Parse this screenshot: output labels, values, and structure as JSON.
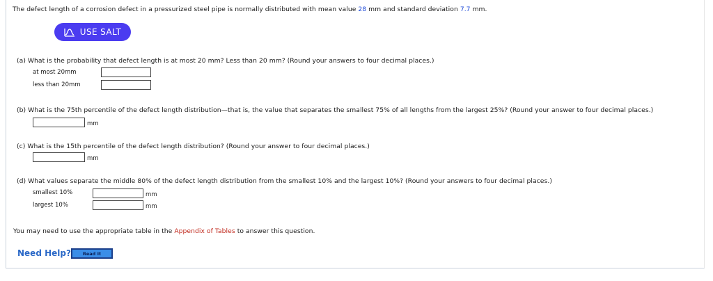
{
  "intro": {
    "prefix": "The defect length of a corrosion defect in a pressurized steel pipe is normally distributed with mean value",
    "mean": "28",
    "mid": "mm and standard deviation",
    "sd": "7.7",
    "suffix": "mm."
  },
  "salt_button": {
    "label": "USE SALT",
    "icon": "salt-chart-icon"
  },
  "part_a": {
    "question": "(a)  What is the probability that defect length is at most 20 mm? Less than 20 mm? (Round your answers to four decimal places.)",
    "label1": "at most 20mm",
    "value1": "",
    "label2": "less than 20mm",
    "value2": ""
  },
  "part_b": {
    "question": "(b)  What is the 75th percentile of the defect length distribution—that is, the value that separates the smallest 75% of all lengths from the largest 25%? (Round your answer to four decimal places.)",
    "value": "",
    "unit": "mm"
  },
  "part_c": {
    "question": "(c)  What is the 15th percentile of the defect length distribution? (Round your answer to four decimal places.)",
    "value": "",
    "unit": "mm"
  },
  "part_d": {
    "question": "(d)  What values separate the middle 80% of the defect length distribution from the smallest 10% and the largest 10%? (Round your answers to four decimal places.)",
    "label1": "smallest 10%",
    "value1": "",
    "unit1": "mm",
    "label2": "largest 10%",
    "value2": "",
    "unit2": "mm"
  },
  "footer_note": {
    "prefix": "You may need to use the appropriate table in the",
    "link": "Appendix of Tables",
    "suffix": "to answer this question."
  },
  "help": {
    "label": "Need Help?",
    "button": "Read It"
  },
  "colors": {
    "highlight": "#1f4bd8",
    "salt_button": "#4b3cf0",
    "link": "#c0281c",
    "help": "#2a68c7"
  }
}
